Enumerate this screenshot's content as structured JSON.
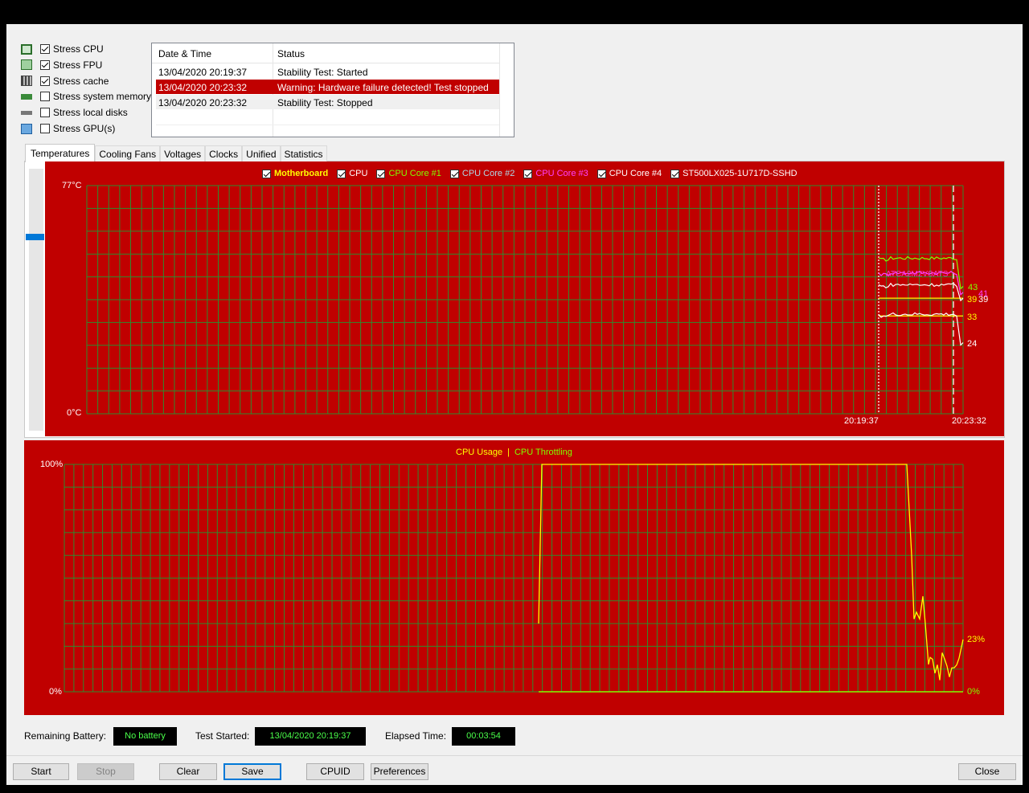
{
  "stress_options": [
    {
      "label": "Stress CPU",
      "checked": true,
      "icon": "cpu-icon"
    },
    {
      "label": "Stress FPU",
      "checked": true,
      "icon": "fpu-icon"
    },
    {
      "label": "Stress cache",
      "checked": true,
      "icon": "cache-icon"
    },
    {
      "label": "Stress system memory",
      "checked": false,
      "icon": "memory-icon"
    },
    {
      "label": "Stress local disks",
      "checked": false,
      "icon": "disk-icon"
    },
    {
      "label": "Stress GPU(s)",
      "checked": false,
      "icon": "gpu-icon"
    }
  ],
  "log": {
    "columns": [
      "Date & Time",
      "Status"
    ],
    "rows": [
      {
        "time": "13/04/2020 20:19:37",
        "status": "Stability Test: Started",
        "highlight": false
      },
      {
        "time": "13/04/2020 20:23:32",
        "status": "Warning: Hardware failure detected! Test stopped",
        "highlight": true
      },
      {
        "time": "13/04/2020 20:23:32",
        "status": "Stability Test: Stopped",
        "highlight": false
      }
    ]
  },
  "tabs": [
    "Temperatures",
    "Cooling Fans",
    "Voltages",
    "Clocks",
    "Unified",
    "Statistics"
  ],
  "colors": {
    "chart_bg": "#c00000",
    "grid": "#2e8b2e",
    "accent": "#0078d7"
  },
  "temp_chart": {
    "legend": [
      {
        "label": "Motherboard",
        "color": "#ffff00",
        "checked": true
      },
      {
        "label": "CPU",
        "color": "#ffffff",
        "checked": true
      },
      {
        "label": "CPU Core #1",
        "color": "#7fff00",
        "checked": true
      },
      {
        "label": "CPU Core #2",
        "color": "#add8e6",
        "checked": true
      },
      {
        "label": "CPU Core #3",
        "color": "#ff40ff",
        "checked": true
      },
      {
        "label": "CPU Core #4",
        "color": "#ffffff",
        "checked": true
      },
      {
        "label": "ST500LX025-1U717D-SSHD",
        "color": "#ffffff",
        "checked": true
      }
    ],
    "y_max_label": "77°C",
    "y_min_label": "0°C",
    "x_labels": [
      "20:19:37",
      "20:23:32"
    ],
    "value_labels": [
      {
        "text": "43",
        "color": "#7fff00",
        "value": 43
      },
      {
        "text": "41",
        "color": "#ff40ff",
        "value": 41
      },
      {
        "text": "39",
        "color": "#ffff00",
        "value": 39
      },
      {
        "text": "39",
        "color": "#ffffff",
        "value": 39
      },
      {
        "text": "33",
        "color": "#ffff00",
        "value": 33
      },
      {
        "text": "24",
        "color": "#ffffff",
        "value": 24
      }
    ],
    "overlay_text": "ATCA2M2VSATS"
  },
  "usage_chart": {
    "legend": [
      {
        "label": "CPU Usage",
        "color": "#ffff00"
      },
      {
        "label": "CPU Throttling",
        "color": "#7fff00"
      }
    ],
    "legend_sep": "|",
    "y_max_label": "100%",
    "y_min_label": "0%",
    "end_labels": [
      {
        "text": "23%",
        "color": "#ffff00"
      },
      {
        "text": "0%",
        "color": "#7fff00"
      }
    ]
  },
  "chart_data": [
    {
      "type": "line",
      "title": "",
      "ylim": [
        0,
        77
      ],
      "y_unit": "°C",
      "x": [
        "20:19:37",
        "20:23:32"
      ],
      "series": [
        {
          "name": "CPU Core #1",
          "values_start": 52,
          "values_end": 43
        },
        {
          "name": "CPU Core #3",
          "values_start": 47,
          "values_end": 41
        },
        {
          "name": "Motherboard",
          "values_start": 39,
          "values_end": 39
        },
        {
          "name": "CPU",
          "values_start": 43,
          "values_end": 39
        },
        {
          "name": "ST500LX025-1U717D-SSHD",
          "values_start": 33,
          "values_end": 33
        },
        {
          "name": "CPU Core #4",
          "values_start": 33,
          "values_end": 24
        }
      ]
    },
    {
      "type": "line",
      "title": "",
      "ylim": [
        0,
        100
      ],
      "y_unit": "%",
      "series": [
        {
          "name": "CPU Usage",
          "end_value": 23
        },
        {
          "name": "CPU Throttling",
          "end_value": 0
        }
      ]
    }
  ],
  "status": {
    "battery_label": "Remaining Battery:",
    "battery_value": "No battery",
    "started_label": "Test Started:",
    "started_value": "13/04/2020 20:19:37",
    "elapsed_label": "Elapsed Time:",
    "elapsed_value": "00:03:54"
  },
  "buttons": {
    "start": "Start",
    "stop": "Stop",
    "clear": "Clear",
    "save": "Save",
    "cpuid": "CPUID",
    "preferences": "Preferences",
    "close": "Close"
  }
}
